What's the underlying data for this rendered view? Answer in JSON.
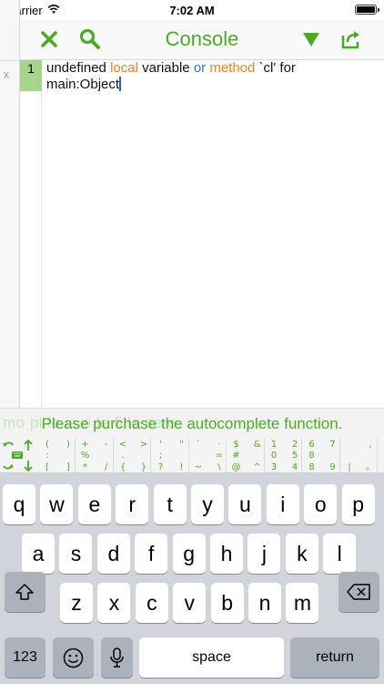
{
  "status": {
    "carrier": "Carrier",
    "time": "7:02 AM"
  },
  "side": {
    "close_glyph": "x"
  },
  "nav": {
    "title": "Console",
    "accent": "#4caa23"
  },
  "editor": {
    "line_number": "1",
    "segments": [
      "undefined ",
      "local",
      " variable ",
      "or",
      " ",
      "method",
      " `cl' for",
      "main:Object"
    ]
  },
  "banner": {
    "message": "Please purchase the autocomplete function.",
    "ghost_text": "mo  pl  lo  is  ri  le  fi  lo  se  e"
  },
  "symbol_keys": [
    [
      "(",
      ")",
      ":",
      "",
      "[",
      "]"
    ],
    [
      "+",
      "-",
      "%",
      "",
      "*",
      "/"
    ],
    [
      "<",
      ">",
      ".",
      "",
      "{",
      "}"
    ],
    [
      "'",
      "\"",
      ";",
      "",
      "?",
      "!"
    ],
    [
      "`",
      "·",
      "",
      "=",
      "~",
      "\\"
    ],
    [
      "$",
      "&",
      "#",
      "",
      "@",
      "^"
    ],
    [
      "1",
      "2",
      "0",
      "5",
      "3",
      "4"
    ],
    [
      "6",
      "7",
      "8",
      "",
      "8",
      "9"
    ],
    [
      "",
      ",",
      "",
      "",
      "|",
      "。"
    ]
  ],
  "keyboard": {
    "row1": [
      "q",
      "w",
      "e",
      "r",
      "t",
      "y",
      "u",
      "i",
      "o",
      "p"
    ],
    "row2": [
      "a",
      "s",
      "d",
      "f",
      "g",
      "h",
      "j",
      "k",
      "l"
    ],
    "row3": [
      "z",
      "x",
      "c",
      "v",
      "b",
      "n",
      "m"
    ],
    "numbers_label": "123",
    "space_label": "space",
    "return_label": "return"
  }
}
